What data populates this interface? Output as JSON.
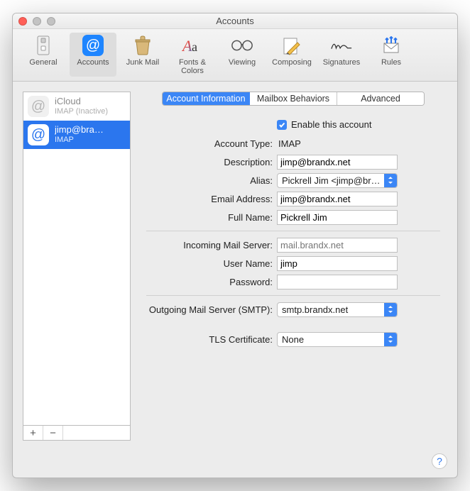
{
  "window": {
    "title": "Accounts"
  },
  "toolbar": {
    "items": [
      {
        "label": "General"
      },
      {
        "label": "Accounts"
      },
      {
        "label": "Junk Mail"
      },
      {
        "label": "Fonts & Colors"
      },
      {
        "label": "Viewing"
      },
      {
        "label": "Composing"
      },
      {
        "label": "Signatures"
      },
      {
        "label": "Rules"
      }
    ]
  },
  "sidebar": {
    "accounts": [
      {
        "name": "iCloud",
        "subtitle": "IMAP (Inactive)"
      },
      {
        "name": "jimp@brandx.net",
        "subtitle": "IMAP"
      }
    ]
  },
  "segmented": {
    "account_info": "Account Information",
    "mailbox_behaviors": "Mailbox Behaviors",
    "advanced": "Advanced"
  },
  "form": {
    "enable_label": "Enable this account",
    "account_type_label": "Account Type:",
    "account_type_value": "IMAP",
    "description_label": "Description:",
    "description_value": "jimp@brandx.net",
    "alias_label": "Alias:",
    "alias_value": "Pickrell Jim <jimp@brandx.net>",
    "email_label": "Email Address:",
    "email_value": "jimp@brandx.net",
    "fullname_label": "Full Name:",
    "fullname_value": "Pickrell Jim",
    "incoming_label": "Incoming Mail Server:",
    "incoming_placeholder": "mail.brandx.net",
    "username_label": "User Name:",
    "username_value": "jimp",
    "password_label": "Password:",
    "password_value": "",
    "outgoing_label": "Outgoing Mail Server (SMTP):",
    "outgoing_value": "smtp.brandx.net",
    "tls_label": "TLS Certificate:",
    "tls_value": "None"
  }
}
